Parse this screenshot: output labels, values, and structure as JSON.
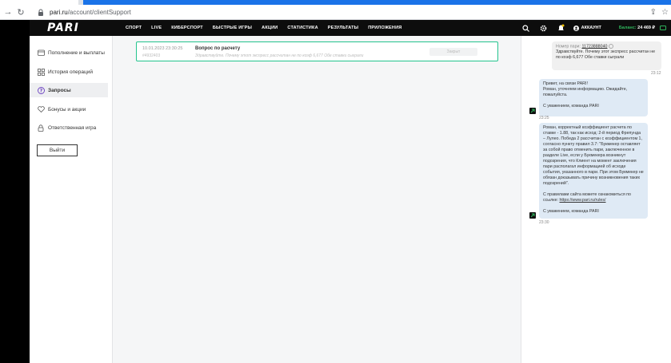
{
  "browser": {
    "url_host": "pari.ru",
    "url_path": "/account/clientSupport"
  },
  "header": {
    "logo": "PARI",
    "nav": [
      "СПОРТ",
      "LIVE",
      "КИБЕРСПОРТ",
      "БЫСТРЫЕ ИГРЫ",
      "АКЦИИ",
      "СТАТИСТИКА",
      "РЕЗУЛЬТАТЫ",
      "ПРИЛОЖЕНИЯ"
    ],
    "account_label": "АККАУНТ",
    "balance_label": "Баланс:",
    "balance_value": "24 469 ₽"
  },
  "sidebar": {
    "items": [
      {
        "label": "Пополнение и выплаты",
        "icon": "wallet-icon"
      },
      {
        "label": "История операций",
        "icon": "grid-icon"
      },
      {
        "label": "Запросы",
        "icon": "question-icon"
      },
      {
        "label": "Бонусы и акции",
        "icon": "heart-icon"
      },
      {
        "label": "Ответственная игра",
        "icon": "lock-icon"
      }
    ],
    "logout_label": "Выйти"
  },
  "request": {
    "date": "10.01.2023 23:30:25",
    "id": "#4932403",
    "title": "Вопрос по расчету",
    "preview": "Здравствуйте. Почему этот экспресс рассчитан не по коэф 6,677 Обе ставки сыграли",
    "status": "Закрыт"
  },
  "chat": {
    "user_message": {
      "bet_label": "Номер пари:",
      "bet_number": "11723888040",
      "text": "Здравствуйте. Почему этот экспресс рассчитан не по коэф 6,677 Обе ставки сыграли",
      "time": "23:12"
    },
    "support_1": {
      "lines": [
        "Привет, на связи PARI!",
        "Роман, уточняем информацию. Ожидайте, пожалуйста."
      ],
      "sign": "С уважением, команда PARI",
      "time": "23:25"
    },
    "support_2": {
      "text": "Роман, корректный коэффициент расчета по ставке - 1.88, так как исход: 2-й период Фрепунда – Лулео. Победа 2 рассчитан с коэффициентом 1, согласно пункту правил 3.7: \"Букмекер оставляет за собой право отменить пари, заключенное в разделе Live, если у Букмекера возникнут подозрения, что Клиент на момент заключения пари располагал информацией об исходе события, указанного в пари. При этом Букмекер не обязан доказывать причину возникновения таких подозрений\".",
      "rules_text": "С правилами сайта можете ознакомиться по ссылке:",
      "rules_link": "https://www.pari.ru/rules/",
      "sign": "С уважением, команда PARI",
      "time": "23:30"
    }
  }
}
